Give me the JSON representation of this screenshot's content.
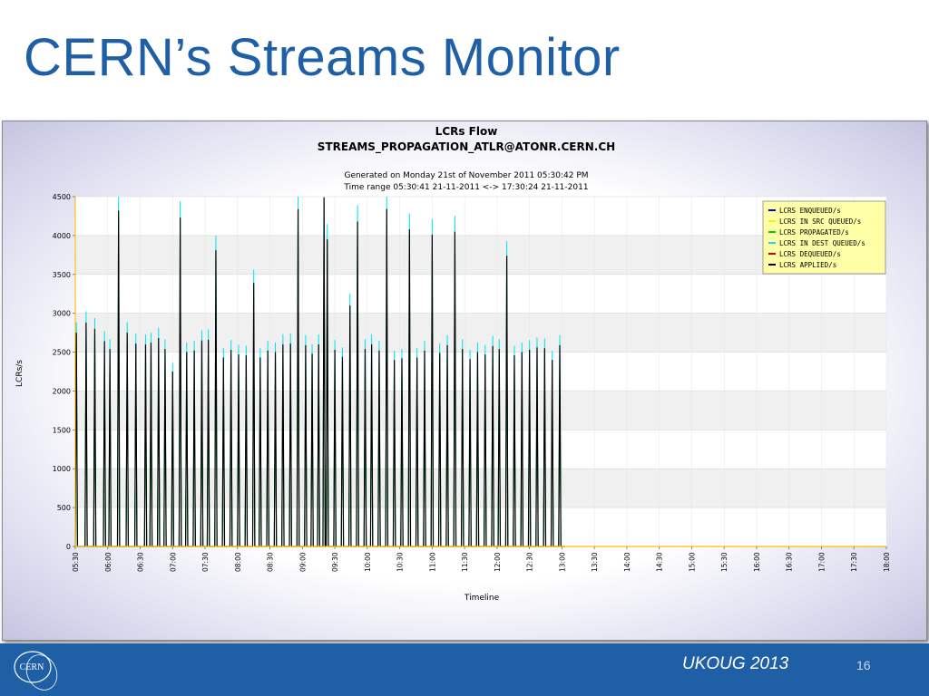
{
  "slide": {
    "title": "CERN’s Streams Monitor",
    "footer": "UKOUG 2013",
    "page_number": "16",
    "logo_text": "CERN"
  },
  "colors": {
    "title": "#1f5fa6",
    "footer_bg": "#1f5fa6",
    "plot_band_a": "#ffffff",
    "plot_band_b": "#f0f0f0",
    "legend_bg": "#ffffa8"
  },
  "chart_data": {
    "type": "line",
    "title": "LCRs Flow",
    "subtitle": "STREAMS_PROPAGATION_ATLR@ATONR.CERN.CH",
    "generated": "Generated on Monday 21st of November 2011 05:30:42 PM",
    "time_range": "Time range 05:30:41 21-11-2011 <-> 17:30:24 21-11-2011",
    "xlabel": "Timeline",
    "ylabel": "LCRs/s",
    "ylim": [
      0,
      4500
    ],
    "xlim": [
      "05:30",
      "18:00"
    ],
    "yticks": [
      "0",
      "500",
      "1000",
      "1500",
      "2000",
      "2500",
      "3000",
      "3500",
      "4000",
      "4500"
    ],
    "xticks": [
      "05:30",
      "06:00",
      "06:30",
      "07:00",
      "07:30",
      "08:00",
      "08:30",
      "09:00",
      "09:30",
      "10:00",
      "10:30",
      "11:00",
      "11:30",
      "12:00",
      "12:30",
      "13:00",
      "13:30",
      "14:00",
      "14:30",
      "15:00",
      "15:30",
      "16:00",
      "16:30",
      "17:00",
      "17:30",
      "18:00"
    ],
    "grid": true,
    "legend_position": "top-right",
    "series": [
      {
        "name": "LCRS ENQUEUED/s",
        "color": "#0000cc"
      },
      {
        "name": "LCRS IN SRC QUEUED/s",
        "color": "#ffee00"
      },
      {
        "name": "LCRS PROPAGATED/s",
        "color": "#00cc00"
      },
      {
        "name": "LCRS IN DEST QUEUED/s",
        "color": "#00e5ee"
      },
      {
        "name": "LCRS DEQUEUED/s",
        "color": "#cc0000"
      },
      {
        "name": "LCRS APPLIED/s",
        "color": "#000000"
      }
    ],
    "spikes": [
      {
        "t": "05:31",
        "v": 2750
      },
      {
        "t": "05:40",
        "v": 2880
      },
      {
        "t": "05:48",
        "v": 2800
      },
      {
        "t": "05:57",
        "v": 2640
      },
      {
        "t": "06:02",
        "v": 2540
      },
      {
        "t": "06:10",
        "v": 4320
      },
      {
        "t": "06:18",
        "v": 2750
      },
      {
        "t": "06:26",
        "v": 2610
      },
      {
        "t": "06:35",
        "v": 2600
      },
      {
        "t": "06:40",
        "v": 2620
      },
      {
        "t": "06:47",
        "v": 2680
      },
      {
        "t": "06:53",
        "v": 2540
      },
      {
        "t": "07:00",
        "v": 2250
      },
      {
        "t": "07:07",
        "v": 4230
      },
      {
        "t": "07:13",
        "v": 2500
      },
      {
        "t": "07:20",
        "v": 2520
      },
      {
        "t": "07:27",
        "v": 2650
      },
      {
        "t": "07:33",
        "v": 2660
      },
      {
        "t": "07:40",
        "v": 3810
      },
      {
        "t": "07:47",
        "v": 2430
      },
      {
        "t": "07:54",
        "v": 2530
      },
      {
        "t": "08:01",
        "v": 2470
      },
      {
        "t": "08:08",
        "v": 2460
      },
      {
        "t": "08:15",
        "v": 3390
      },
      {
        "t": "08:21",
        "v": 2430
      },
      {
        "t": "08:28",
        "v": 2520
      },
      {
        "t": "08:35",
        "v": 2500
      },
      {
        "t": "08:42",
        "v": 2600
      },
      {
        "t": "08:49",
        "v": 2610
      },
      {
        "t": "08:56",
        "v": 4340
      },
      {
        "t": "09:03",
        "v": 2590
      },
      {
        "t": "09:09",
        "v": 2480
      },
      {
        "t": "09:15",
        "v": 2600
      },
      {
        "t": "09:20",
        "v": 4490
      },
      {
        "t": "09:23",
        "v": 3950
      },
      {
        "t": "09:30",
        "v": 2530
      },
      {
        "t": "09:37",
        "v": 2440
      },
      {
        "t": "09:44",
        "v": 3100
      },
      {
        "t": "09:51",
        "v": 4180
      },
      {
        "t": "09:58",
        "v": 2540
      },
      {
        "t": "10:04",
        "v": 2600
      },
      {
        "t": "10:11",
        "v": 2520
      },
      {
        "t": "10:18",
        "v": 4340
      },
      {
        "t": "10:25",
        "v": 2400
      },
      {
        "t": "10:32",
        "v": 2420
      },
      {
        "t": "10:39",
        "v": 4080
      },
      {
        "t": "10:46",
        "v": 2430
      },
      {
        "t": "10:53",
        "v": 2520
      },
      {
        "t": "11:00",
        "v": 4010
      },
      {
        "t": "11:07",
        "v": 2490
      },
      {
        "t": "11:14",
        "v": 2590
      },
      {
        "t": "11:21",
        "v": 4050
      },
      {
        "t": "11:28",
        "v": 2540
      },
      {
        "t": "11:35",
        "v": 2410
      },
      {
        "t": "11:42",
        "v": 2500
      },
      {
        "t": "11:49",
        "v": 2470
      },
      {
        "t": "11:56",
        "v": 2580
      },
      {
        "t": "12:02",
        "v": 2540
      },
      {
        "t": "12:09",
        "v": 3740
      },
      {
        "t": "12:16",
        "v": 2460
      },
      {
        "t": "12:23",
        "v": 2500
      },
      {
        "t": "12:30",
        "v": 2530
      },
      {
        "t": "12:37",
        "v": 2560
      },
      {
        "t": "12:44",
        "v": 2550
      },
      {
        "t": "12:51",
        "v": 2400
      },
      {
        "t": "12:58",
        "v": 2590
      }
    ]
  }
}
